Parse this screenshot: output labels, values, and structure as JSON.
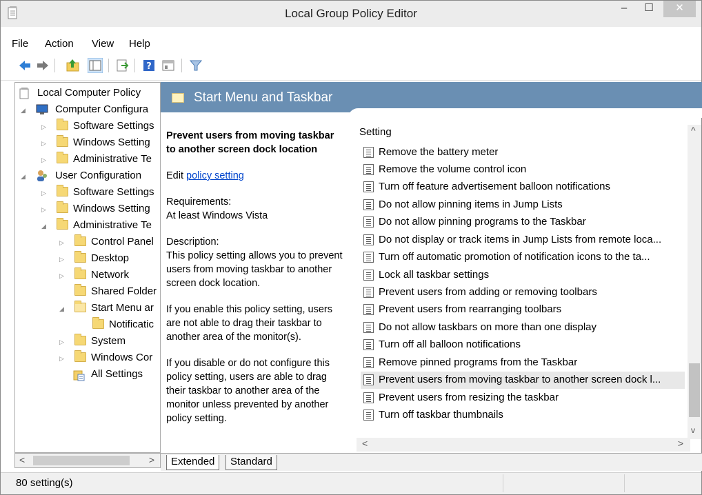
{
  "window": {
    "title": "Local Group Policy Editor",
    "min_label": "–",
    "max_label": "☐",
    "close_label": "✕"
  },
  "menu": {
    "file": "File",
    "action": "Action",
    "view": "View",
    "help": "Help"
  },
  "toolbar": {
    "icons": [
      "back-icon",
      "forward-icon",
      "up-folder-icon",
      "show-hide-tree-icon",
      "export-list-icon",
      "help-icon",
      "properties-icon",
      "filter-icon"
    ]
  },
  "tree": {
    "nodes": [
      {
        "label": "Local Computer Policy",
        "icon": "policy-icon"
      },
      {
        "label": "Computer Configura",
        "icon": "computer-icon"
      },
      {
        "label": "Software Settings",
        "icon": "folder-icon"
      },
      {
        "label": "Windows Setting",
        "icon": "folder-icon"
      },
      {
        "label": "Administrative Te",
        "icon": "folder-icon"
      },
      {
        "label": "User Configuration",
        "icon": "user-icon"
      },
      {
        "label": "Software Settings",
        "icon": "folder-icon"
      },
      {
        "label": "Windows Setting",
        "icon": "folder-icon"
      },
      {
        "label": "Administrative Te",
        "icon": "folder-icon"
      },
      {
        "label": "Control Panel",
        "icon": "folder-icon"
      },
      {
        "label": "Desktop",
        "icon": "folder-icon"
      },
      {
        "label": "Network",
        "icon": "folder-icon"
      },
      {
        "label": "Shared Folder",
        "icon": "folder-icon"
      },
      {
        "label": "Start Menu ar",
        "icon": "folder-open-icon"
      },
      {
        "label": "Notificatic",
        "icon": "folder-icon"
      },
      {
        "label": "System",
        "icon": "folder-icon"
      },
      {
        "label": "Windows Cor",
        "icon": "folder-icon"
      },
      {
        "label": "All Settings",
        "icon": "settings-icon"
      }
    ],
    "scroll_left": "<",
    "scroll_right": ">"
  },
  "header": {
    "title": "Start Menu and Taskbar"
  },
  "description": {
    "title": "Prevent users from moving taskbar to another screen dock location",
    "edit_prefix": "Edit ",
    "edit_link": "policy setting ",
    "req_label": "Requirements:",
    "req_value": "At least Windows Vista",
    "desc_label": "Description:",
    "desc_1": "This policy setting allows you to prevent users from moving taskbar to another screen dock location.",
    "desc_2": "If you enable this policy setting, users are not able to drag their taskbar to another area of the monitor(s).",
    "desc_3": "If you disable or do not configure this policy setting, users are able to drag their taskbar to another area of the monitor unless prevented by another policy setting."
  },
  "list": {
    "column": "Setting",
    "rows": [
      "Remove the battery meter",
      "Remove the volume control icon",
      "Turn off feature advertisement balloon notifications",
      "Do not allow pinning items in Jump Lists",
      "Do not allow pinning programs to the Taskbar",
      "Do not display or track items in Jump Lists from remote loca...",
      "Turn off automatic promotion of notification icons to the ta...",
      "Lock all taskbar settings",
      "Prevent users from adding or removing toolbars",
      "Prevent users from rearranging toolbars",
      "Do not allow taskbars on more than one display",
      "Turn off all balloon notifications",
      "Remove pinned programs from the Taskbar",
      "Prevent users from moving taskbar to another screen dock l...",
      "Prevent users from resizing the taskbar",
      "Turn off taskbar thumbnails"
    ],
    "selected_index": 13,
    "scroll_up": "^",
    "scroll_down": "v",
    "scroll_left": "<",
    "scroll_right": ">"
  },
  "tabs": {
    "extended": "Extended",
    "standard": "Standard"
  },
  "status": {
    "text": "80 setting(s)"
  },
  "colors": {
    "header_blue": "#6a8fb3",
    "link_blue": "#0044cc"
  }
}
